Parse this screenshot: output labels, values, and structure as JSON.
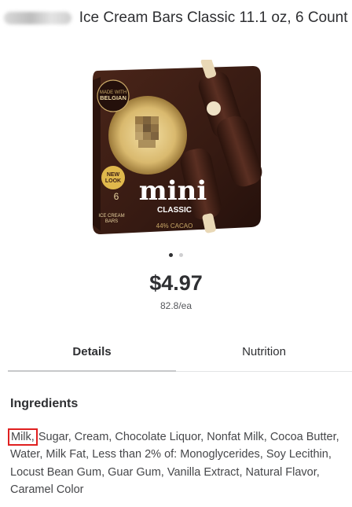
{
  "product": {
    "title": "Ice Cream Bars Classic 11.1 oz, 6 Count",
    "price": "$4.97",
    "unit_price": "82.8/ea",
    "image": {
      "badge_top": "MADE WITH BELGIAN CHOCOLATE",
      "new_look": "NEW LOOK",
      "brand_word": "mini",
      "variant": "CLASSIC",
      "cacao": "44% CACAO",
      "count": "6",
      "count_label": "ICE CREAM BARS"
    }
  },
  "carousel": {
    "total": 2,
    "active": 1
  },
  "tabs": [
    {
      "label": "Details",
      "selected": true
    },
    {
      "label": "Nutrition",
      "selected": false
    }
  ],
  "ingredients": {
    "heading": "Ingredients",
    "highlighted": "Milk,",
    "rest": " Sugar, Cream, Chocolate Liquor, Nonfat Milk, Cocoa Butter, Water, Milk Fat, Less than 2% of: Monoglycerides, Soy Lecithin, Locust Bean Gum, Guar Gum, Vanilla Extract, Natural Flavor, Caramel Color"
  },
  "colors": {
    "box_brown": "#3a1d14",
    "gold": "#c9a867",
    "highlight_red": "#e02020"
  }
}
